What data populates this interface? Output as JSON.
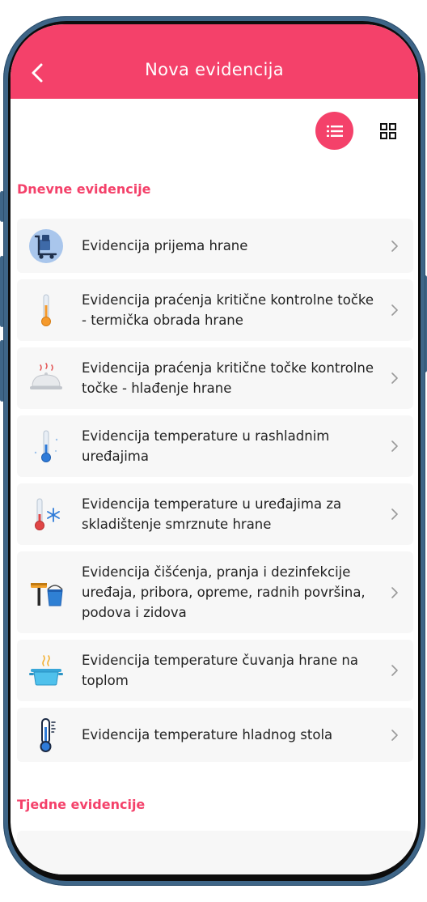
{
  "header": {
    "title": "Nova evidencija"
  },
  "sections": {
    "daily": {
      "title": "Dnevne evidencije",
      "items": [
        {
          "label": "Evidencija prijema hrane",
          "icon": "delivery-cart-icon"
        },
        {
          "label": "Evidencija praćenja kritične kontrolne točke - termička obrada hrane",
          "icon": "thermometer-hot-icon"
        },
        {
          "label": "Evidencija praćenja kritične točke kontrolne točke - hlađenje hrane",
          "icon": "food-cloche-icon"
        },
        {
          "label": "Evidencija temperature u rashladnim uređajima",
          "icon": "thermometer-cold-icon"
        },
        {
          "label": "Evidencija temperature u uređajima za skladištenje smrznute hrane",
          "icon": "thermometer-snowflake-icon"
        },
        {
          "label": "Evidencija čišćenja, pranja i dezinfekcije uređaja, pribora, opreme, radnih površina, podova i zidova",
          "icon": "cleaning-bucket-icon"
        },
        {
          "label": "Evidencija temperature čuvanja hrane na toplom",
          "icon": "hot-pot-icon"
        },
        {
          "label": "Evidencija temperature hladnog stola",
          "icon": "thermometer-scale-icon"
        }
      ]
    },
    "weekly": {
      "title": "Tjedne evidencije"
    }
  },
  "colors": {
    "accent": "#f4416a",
    "frame": "#3e6587",
    "item_bg": "#f7f7f7"
  }
}
